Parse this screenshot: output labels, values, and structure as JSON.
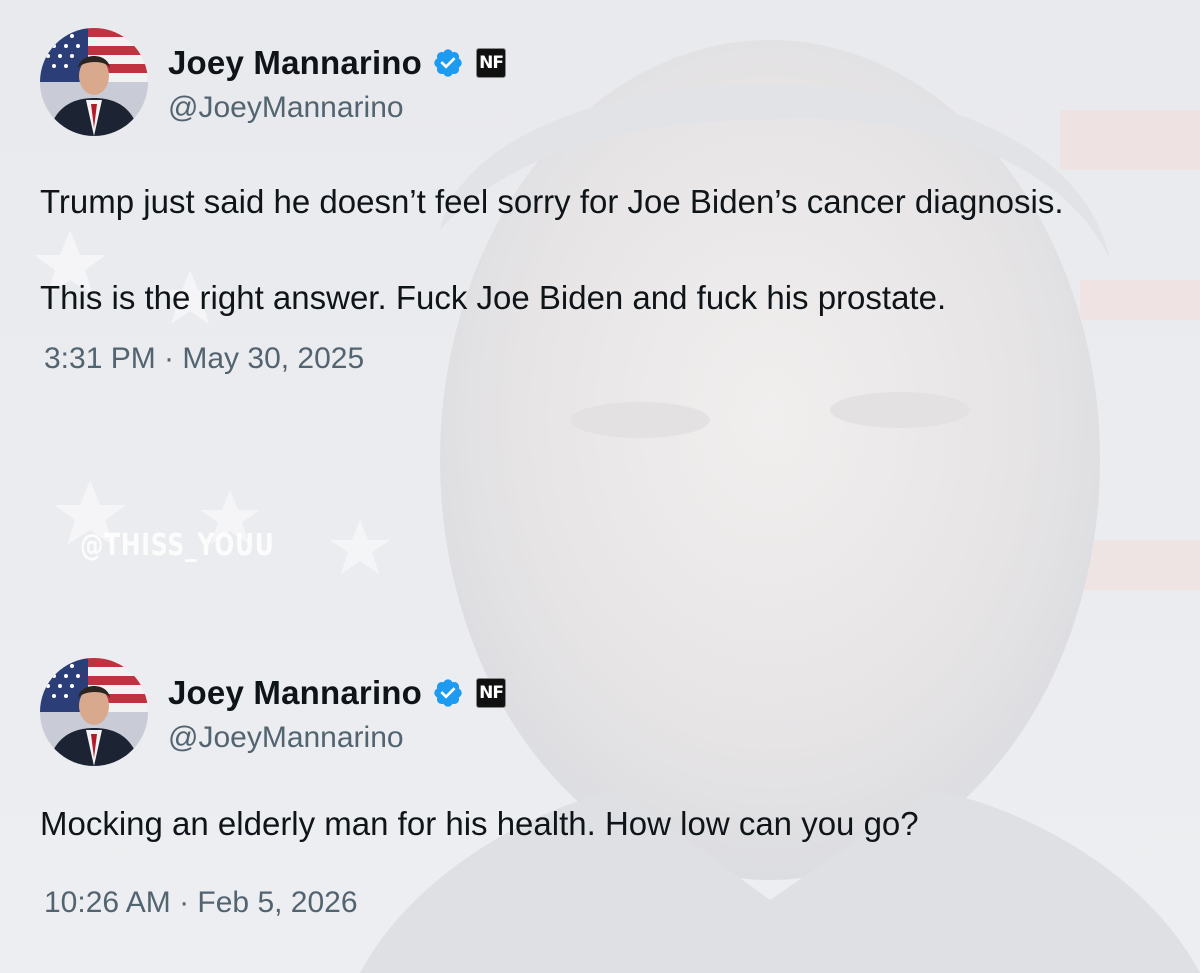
{
  "watermark": "@THISS_YOUU",
  "tweets": [
    {
      "display_name": "Joey Mannarino",
      "handle": "@JoeyMannarino",
      "badge": "NF",
      "text": "Trump just said he doesn’t feel sorry for Joe Biden’s cancer diagnosis.\n\nThis is the right answer. Fuck Joe Biden and fuck his prostate.",
      "timestamp": "3:31 PM · May 30, 2025"
    },
    {
      "display_name": "Joey Mannarino",
      "handle": "@JoeyMannarino",
      "badge": "NF",
      "text": "Mocking an elderly man for his health. How low can you go?",
      "timestamp": "10:26 AM · Feb 5, 2026"
    }
  ],
  "colors": {
    "verified_blue": "#1d9bf0",
    "text_primary": "#0f1419",
    "text_secondary": "#536471"
  }
}
